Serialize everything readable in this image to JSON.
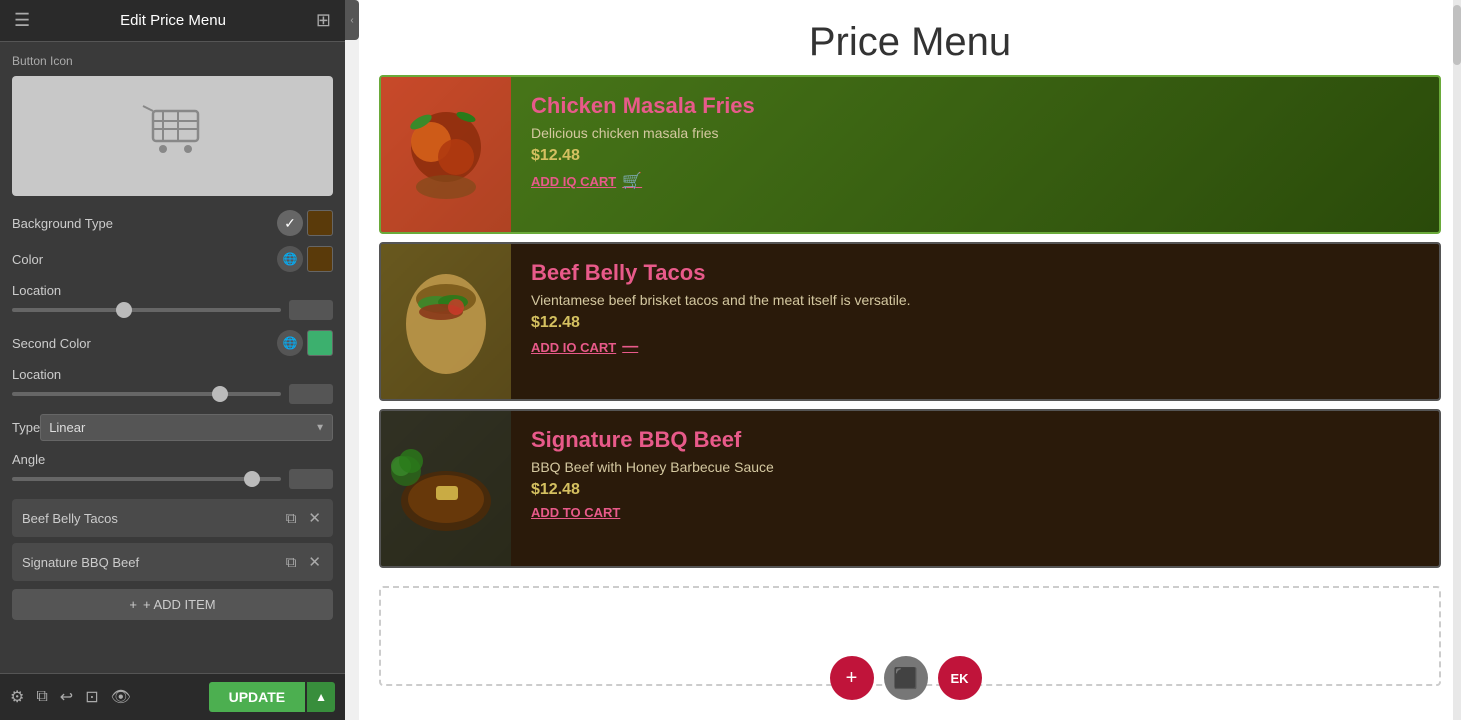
{
  "panel": {
    "title": "Edit Price Menu",
    "section_label": "Button Icon",
    "background_type_label": "Background Type",
    "color_label": "Color",
    "location_label": "Location",
    "location_value_1": "41",
    "second_color_label": "Second Color",
    "location_value_2": "79",
    "type_label": "Type",
    "type_value": "Linear",
    "angle_label": "Angle",
    "angle_value": "330",
    "items": [
      {
        "name": "Beef Belly Tacos"
      },
      {
        "name": "Signature BBQ Beef"
      }
    ],
    "add_item_label": "+ ADD ITEM",
    "update_label": "UPDATE"
  },
  "preview": {
    "page_title": "Price Menu",
    "menu_items": [
      {
        "name": "Chicken Masala Fries",
        "description": "Delicious chicken masala fries",
        "price": "$12.48",
        "add_to_cart": "ADD IQ CART",
        "card_class": "card-1",
        "img_class": "img-chicken"
      },
      {
        "name": "Beef Belly Tacos",
        "description": "Vientamese beef brisket tacos and the meat itself is versatile.",
        "price": "$12.48",
        "add_to_cart": "ADD TO CART",
        "card_class": "card-2",
        "img_class": "img-beef-tacos"
      },
      {
        "name": "Signature BBQ Beef",
        "description": "BBQ Beef with Honey Barbecue Sauce",
        "price": "$12.48",
        "add_to_cart": "ADD TO CART",
        "card_class": "card-3",
        "img_class": "img-bbq-beef"
      }
    ]
  },
  "toolbar": {
    "add_icon": "+",
    "stop_icon": "⬛",
    "ek_label": "EK"
  },
  "icons": {
    "menu": "☰",
    "grid": "⊞",
    "check": "✓",
    "globe": "🌐",
    "copy": "⧉",
    "close": "✕",
    "plus": "+",
    "settings": "⚙",
    "layers": "⧉",
    "undo": "↩",
    "responsive": "⊡",
    "eye": "👁",
    "chevron_down": "▼",
    "chevron_left": "‹"
  }
}
